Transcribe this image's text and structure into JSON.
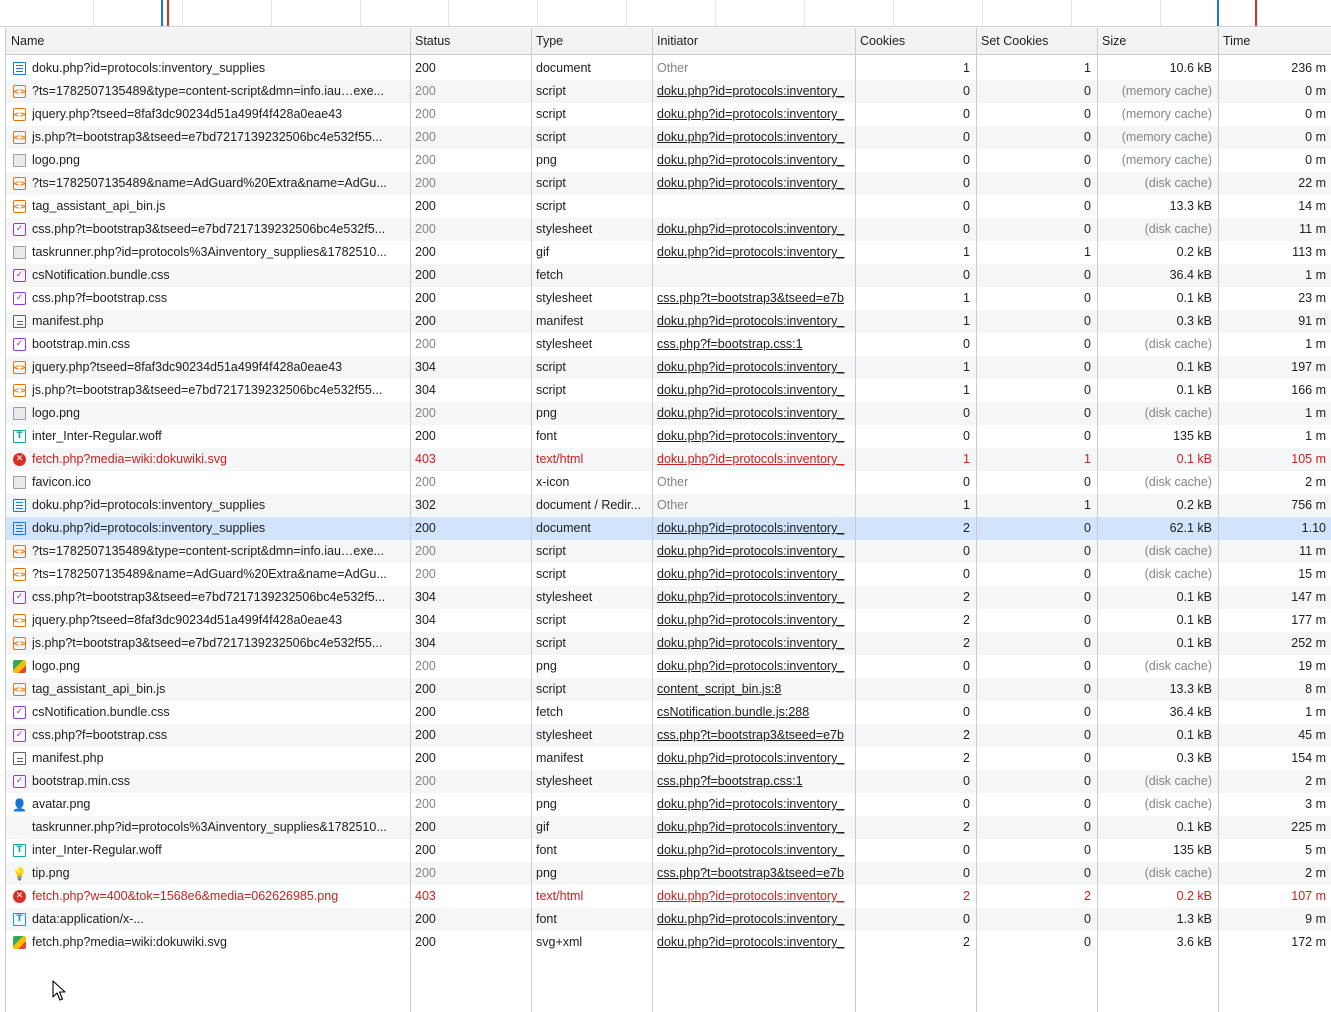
{
  "columns": {
    "name": "Name",
    "status": "Status",
    "type": "Type",
    "initiator": "Initiator",
    "cookies": "Cookies",
    "set_cookies": "Set Cookies",
    "size": "Size",
    "time": "Time"
  },
  "rows": [
    {
      "icon": "document-icon",
      "name": "doku.php?id=protocols:inventory_supplies",
      "status": "200",
      "type": "document",
      "initiator": "Other",
      "initiator_link": false,
      "cookies": "1",
      "set_cookies": "1",
      "size": "10.6 kB",
      "time": "236 m",
      "state": "normal"
    },
    {
      "icon": "script-icon",
      "name": "?ts=1782507135489&type=content-script&dmn=info.iau…exe...",
      "status": "200",
      "type": "script",
      "initiator": "doku.php?id=protocols:inventory_",
      "initiator_link": true,
      "cookies": "0",
      "set_cookies": "0",
      "size": "(memory cache)",
      "time": "0 m",
      "state": "dim"
    },
    {
      "icon": "script-icon",
      "name": "jquery.php?tseed=8faf3dc90234d51a499f4f428a0eae43",
      "status": "200",
      "type": "script",
      "initiator": "doku.php?id=protocols:inventory_",
      "initiator_link": true,
      "cookies": "0",
      "set_cookies": "0",
      "size": "(memory cache)",
      "time": "0 m",
      "state": "dim"
    },
    {
      "icon": "script-icon",
      "name": "js.php?t=bootstrap3&tseed=e7bd7217139232506bc4e532f55...",
      "status": "200",
      "type": "script",
      "initiator": "doku.php?id=protocols:inventory_",
      "initiator_link": true,
      "cookies": "0",
      "set_cookies": "0",
      "size": "(memory cache)",
      "time": "0 m",
      "state": "dim"
    },
    {
      "icon": "image-icon",
      "name": "logo.png",
      "status": "200",
      "type": "png",
      "initiator": "doku.php?id=protocols:inventory_",
      "initiator_link": true,
      "cookies": "0",
      "set_cookies": "0",
      "size": "(memory cache)",
      "time": "0 m",
      "state": "dim"
    },
    {
      "icon": "script-icon",
      "name": "?ts=1782507135489&name=AdGuard%20Extra&name=AdGu...",
      "status": "200",
      "type": "script",
      "initiator": "doku.php?id=protocols:inventory_",
      "initiator_link": true,
      "cookies": "0",
      "set_cookies": "0",
      "size": "(disk cache)",
      "time": "22 m",
      "state": "dim"
    },
    {
      "icon": "script-icon",
      "name": "tag_assistant_api_bin.js",
      "status": "200",
      "type": "script",
      "initiator": "",
      "initiator_link": false,
      "cookies": "0",
      "set_cookies": "0",
      "size": "13.3 kB",
      "time": "14 m",
      "state": "normal"
    },
    {
      "icon": "stylesheet-icon",
      "name": "css.php?t=bootstrap3&tseed=e7bd7217139232506bc4e532f5...",
      "status": "200",
      "type": "stylesheet",
      "initiator": "doku.php?id=protocols:inventory_",
      "initiator_link": true,
      "cookies": "0",
      "set_cookies": "0",
      "size": "(disk cache)",
      "time": "11 m",
      "state": "dim"
    },
    {
      "icon": "image-icon",
      "name": "taskrunner.php?id=protocols%3Ainventory_supplies&1782510...",
      "status": "200",
      "type": "gif",
      "initiator": "doku.php?id=protocols:inventory_",
      "initiator_link": true,
      "cookies": "1",
      "set_cookies": "1",
      "size": "0.2 kB",
      "time": "113 m",
      "state": "normal"
    },
    {
      "icon": "stylesheet-icon",
      "name": "csNotification.bundle.css",
      "status": "200",
      "type": "fetch",
      "initiator": "",
      "initiator_link": false,
      "cookies": "0",
      "set_cookies": "0",
      "size": "36.4 kB",
      "time": "1 m",
      "state": "normal"
    },
    {
      "icon": "stylesheet-icon",
      "name": "css.php?f=bootstrap.css",
      "status": "200",
      "type": "stylesheet",
      "initiator": "css.php?t=bootstrap3&tseed=e7b",
      "initiator_link": true,
      "cookies": "1",
      "set_cookies": "0",
      "size": "0.1 kB",
      "time": "23 m",
      "state": "normal"
    },
    {
      "icon": "manifest-icon",
      "name": "manifest.php",
      "status": "200",
      "type": "manifest",
      "initiator": "doku.php?id=protocols:inventory_",
      "initiator_link": true,
      "cookies": "1",
      "set_cookies": "0",
      "size": "0.3 kB",
      "time": "91 m",
      "state": "normal"
    },
    {
      "icon": "stylesheet-icon",
      "name": "bootstrap.min.css",
      "status": "200",
      "type": "stylesheet",
      "initiator": "css.php?f=bootstrap.css:1",
      "initiator_link": true,
      "cookies": "0",
      "set_cookies": "0",
      "size": "(disk cache)",
      "time": "1 m",
      "state": "dim"
    },
    {
      "icon": "script-icon",
      "name": "jquery.php?tseed=8faf3dc90234d51a499f4f428a0eae43",
      "status": "304",
      "type": "script",
      "initiator": "doku.php?id=protocols:inventory_",
      "initiator_link": true,
      "cookies": "1",
      "set_cookies": "0",
      "size": "0.1 kB",
      "time": "197 m",
      "state": "normal"
    },
    {
      "icon": "script-icon",
      "name": "js.php?t=bootstrap3&tseed=e7bd7217139232506bc4e532f55...",
      "status": "304",
      "type": "script",
      "initiator": "doku.php?id=protocols:inventory_",
      "initiator_link": true,
      "cookies": "1",
      "set_cookies": "0",
      "size": "0.1 kB",
      "time": "166 m",
      "state": "normal"
    },
    {
      "icon": "image-icon",
      "name": "logo.png",
      "status": "200",
      "type": "png",
      "initiator": "doku.php?id=protocols:inventory_",
      "initiator_link": true,
      "cookies": "0",
      "set_cookies": "0",
      "size": "(disk cache)",
      "time": "1 m",
      "state": "dim"
    },
    {
      "icon": "font-icon",
      "name": "inter_Inter-Regular.woff",
      "status": "200",
      "type": "font",
      "initiator": "doku.php?id=protocols:inventory_",
      "initiator_link": true,
      "cookies": "0",
      "set_cookies": "0",
      "size": "135 kB",
      "time": "1 m",
      "state": "normal"
    },
    {
      "icon": "error-icon",
      "name": "fetch.php?media=wiki:dokuwiki.svg",
      "status": "403",
      "type": "text/html",
      "initiator": "doku.php?id=protocols:inventory_",
      "initiator_link": true,
      "cookies": "1",
      "set_cookies": "1",
      "size": "0.1 kB",
      "time": "105 m",
      "state": "error"
    },
    {
      "icon": "image-icon",
      "name": "favicon.ico",
      "status": "200",
      "type": "x-icon",
      "initiator": "Other",
      "initiator_link": false,
      "cookies": "0",
      "set_cookies": "0",
      "size": "(disk cache)",
      "time": "2 m",
      "state": "dim"
    },
    {
      "icon": "document-icon",
      "name": "doku.php?id=protocols:inventory_supplies",
      "status": "302",
      "type": "document / Redir...",
      "initiator": "Other",
      "initiator_link": false,
      "cookies": "1",
      "set_cookies": "1",
      "size": "0.2 kB",
      "time": "756 m",
      "state": "normal"
    },
    {
      "icon": "document-icon",
      "name": "doku.php?id=protocols:inventory_supplies",
      "status": "200",
      "type": "document",
      "initiator": "doku.php?id=protocols:inventory_",
      "initiator_link": true,
      "cookies": "2",
      "set_cookies": "0",
      "size": "62.1 kB",
      "time": "1.10",
      "state": "selected"
    },
    {
      "icon": "script-icon",
      "name": "?ts=1782507135489&type=content-script&dmn=info.iau…exe...",
      "status": "200",
      "type": "script",
      "initiator": "doku.php?id=protocols:inventory_",
      "initiator_link": true,
      "cookies": "0",
      "set_cookies": "0",
      "size": "(disk cache)",
      "time": "11 m",
      "state": "dim"
    },
    {
      "icon": "script-icon",
      "name": "?ts=1782507135489&name=AdGuard%20Extra&name=AdGu...",
      "status": "200",
      "type": "script",
      "initiator": "doku.php?id=protocols:inventory_",
      "initiator_link": true,
      "cookies": "0",
      "set_cookies": "0",
      "size": "(disk cache)",
      "time": "15 m",
      "state": "dim"
    },
    {
      "icon": "stylesheet-icon",
      "name": "css.php?t=bootstrap3&tseed=e7bd7217139232506bc4e532f5...",
      "status": "304",
      "type": "stylesheet",
      "initiator": "doku.php?id=protocols:inventory_",
      "initiator_link": true,
      "cookies": "2",
      "set_cookies": "0",
      "size": "0.1 kB",
      "time": "147 m",
      "state": "normal"
    },
    {
      "icon": "script-icon",
      "name": "jquery.php?tseed=8faf3dc90234d51a499f4f428a0eae43",
      "status": "304",
      "type": "script",
      "initiator": "doku.php?id=protocols:inventory_",
      "initiator_link": true,
      "cookies": "2",
      "set_cookies": "0",
      "size": "0.1 kB",
      "time": "177 m",
      "state": "normal"
    },
    {
      "icon": "script-icon",
      "name": "js.php?t=bootstrap3&tseed=e7bd7217139232506bc4e532f55...",
      "status": "304",
      "type": "script",
      "initiator": "doku.php?id=protocols:inventory_",
      "initiator_link": true,
      "cookies": "2",
      "set_cookies": "0",
      "size": "0.1 kB",
      "time": "252 m",
      "state": "normal"
    },
    {
      "icon": "image-color-icon",
      "name": "logo.png",
      "status": "200",
      "type": "png",
      "initiator": "doku.php?id=protocols:inventory_",
      "initiator_link": true,
      "cookies": "0",
      "set_cookies": "0",
      "size": "(disk cache)",
      "time": "19 m",
      "state": "dim"
    },
    {
      "icon": "script-icon",
      "name": "tag_assistant_api_bin.js",
      "status": "200",
      "type": "script",
      "initiator": "content_script_bin.js:8",
      "initiator_link": true,
      "cookies": "0",
      "set_cookies": "0",
      "size": "13.3 kB",
      "time": "8 m",
      "state": "normal"
    },
    {
      "icon": "stylesheet-icon",
      "name": "csNotification.bundle.css",
      "status": "200",
      "type": "fetch",
      "initiator": "csNotification.bundle.js:288",
      "initiator_link": true,
      "cookies": "0",
      "set_cookies": "0",
      "size": "36.4 kB",
      "time": "1 m",
      "state": "normal"
    },
    {
      "icon": "stylesheet-icon",
      "name": "css.php?f=bootstrap.css",
      "status": "200",
      "type": "stylesheet",
      "initiator": "css.php?t=bootstrap3&tseed=e7b",
      "initiator_link": true,
      "cookies": "2",
      "set_cookies": "0",
      "size": "0.1 kB",
      "time": "45 m",
      "state": "normal"
    },
    {
      "icon": "manifest-icon",
      "name": "manifest.php",
      "status": "200",
      "type": "manifest",
      "initiator": "doku.php?id=protocols:inventory_",
      "initiator_link": true,
      "cookies": "2",
      "set_cookies": "0",
      "size": "0.3 kB",
      "time": "154 m",
      "state": "normal"
    },
    {
      "icon": "stylesheet-icon",
      "name": "bootstrap.min.css",
      "status": "200",
      "type": "stylesheet",
      "initiator": "css.php?f=bootstrap.css:1",
      "initiator_link": true,
      "cookies": "0",
      "set_cookies": "0",
      "size": "(disk cache)",
      "time": "2 m",
      "state": "dim"
    },
    {
      "icon": "avatar-icon",
      "name": "avatar.png",
      "status": "200",
      "type": "png",
      "initiator": "doku.php?id=protocols:inventory_",
      "initiator_link": true,
      "cookies": "0",
      "set_cookies": "0",
      "size": "(disk cache)",
      "time": "3 m",
      "state": "dim"
    },
    {
      "icon": "none",
      "name": "taskrunner.php?id=protocols%3Ainventory_supplies&1782510...",
      "status": "200",
      "type": "gif",
      "initiator": "doku.php?id=protocols:inventory_",
      "initiator_link": true,
      "cookies": "2",
      "set_cookies": "0",
      "size": "0.1 kB",
      "time": "225 m",
      "state": "normal"
    },
    {
      "icon": "font-icon",
      "name": "inter_Inter-Regular.woff",
      "status": "200",
      "type": "font",
      "initiator": "doku.php?id=protocols:inventory_",
      "initiator_link": true,
      "cookies": "0",
      "set_cookies": "0",
      "size": "135 kB",
      "time": "5 m",
      "state": "normal"
    },
    {
      "icon": "tip-icon",
      "name": "tip.png",
      "status": "200",
      "type": "png",
      "initiator": "css.php?t=bootstrap3&tseed=e7b",
      "initiator_link": true,
      "cookies": "0",
      "set_cookies": "0",
      "size": "(disk cache)",
      "time": "2 m",
      "state": "dim"
    },
    {
      "icon": "error-icon",
      "name": "fetch.php?w=400&tok=1568e6&media=062626985.png",
      "status": "403",
      "type": "text/html",
      "initiator": "doku.php?id=protocols:inventory_",
      "initiator_link": true,
      "cookies": "2",
      "set_cookies": "2",
      "size": "0.2 kB",
      "time": "107 m",
      "state": "error"
    },
    {
      "icon": "font-icon",
      "name": "data:application/x-...",
      "status": "200",
      "type": "font",
      "initiator": "doku.php?id=protocols:inventory_",
      "initiator_link": true,
      "cookies": "0",
      "set_cookies": "0",
      "size": "1.3 kB",
      "time": "9 m",
      "state": "normal"
    },
    {
      "icon": "image-color-icon",
      "name": "fetch.php?media=wiki:dokuwiki.svg",
      "status": "200",
      "type": "svg+xml",
      "initiator": "doku.php?id=protocols:inventory_",
      "initiator_link": true,
      "cookies": "2",
      "set_cookies": "0",
      "size": "3.6 kB",
      "time": "172 m",
      "state": "normal"
    }
  ],
  "colors": {
    "selected_row": "#d2e3fc",
    "error_text": "#c5221f",
    "dim_text": "#80868b",
    "header_bg": "#f1f3f4",
    "overview_blue": "#1a73e8",
    "overview_red": "#d93025"
  }
}
